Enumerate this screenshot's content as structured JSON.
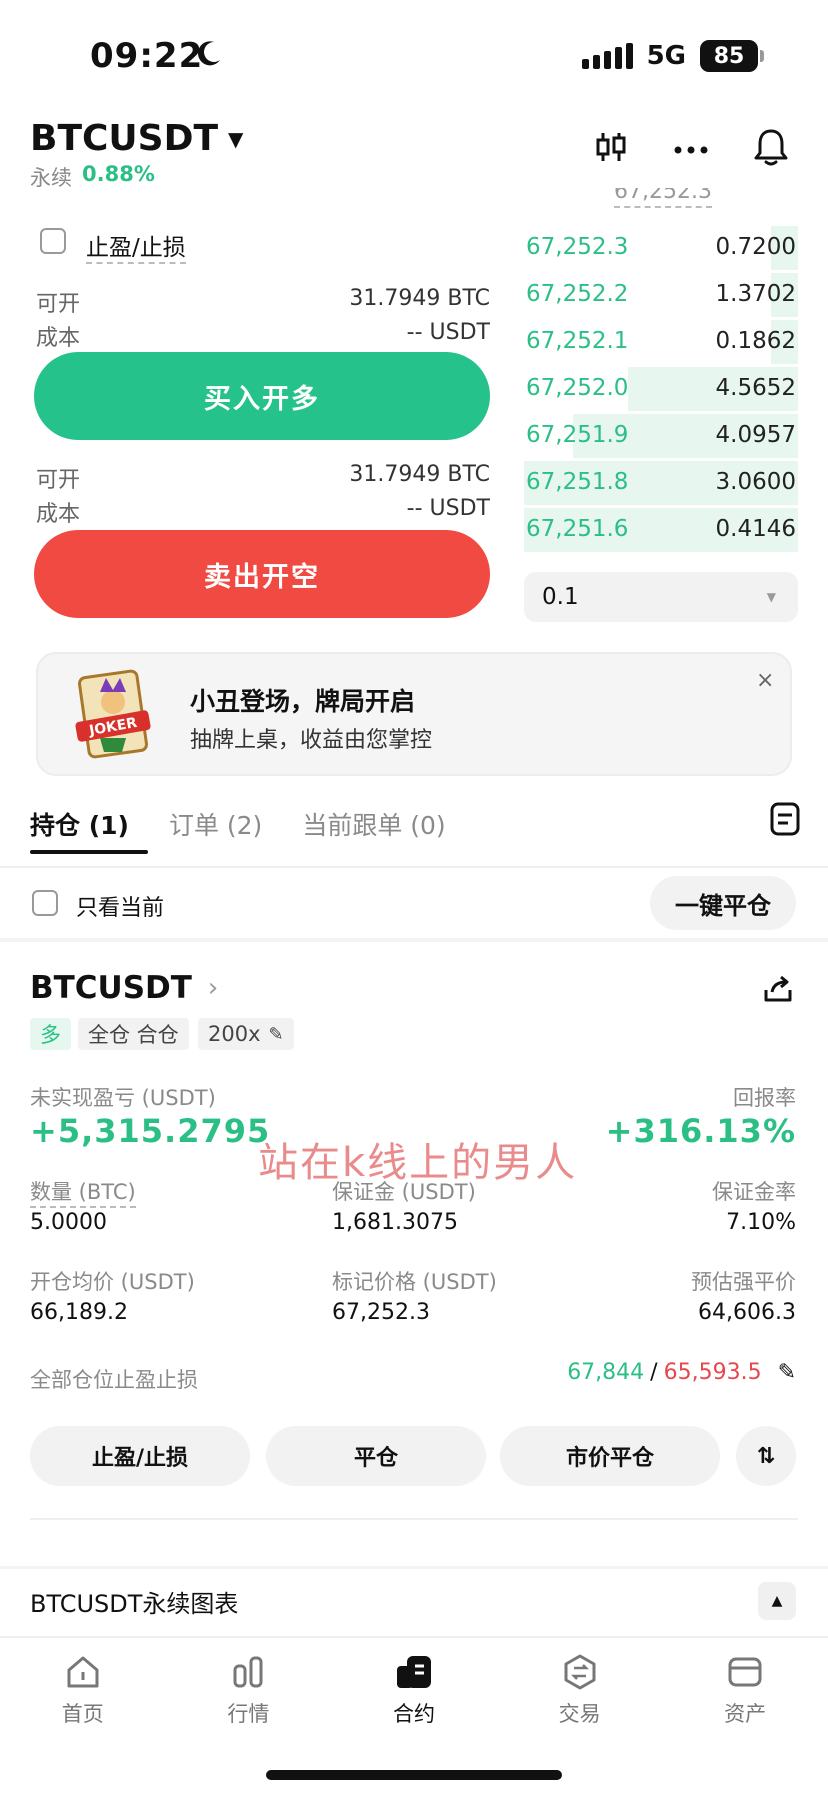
{
  "status_bar": {
    "time": "09:22",
    "network": "5G",
    "battery": "85"
  },
  "header": {
    "pair": "BTCUSDT",
    "type": "永续",
    "change": "0.88%"
  },
  "orderbook": {
    "top_price": "67,252.3",
    "rows": [
      {
        "price": "67,252.3",
        "amount": "0.7200",
        "depth": 0.1
      },
      {
        "price": "67,252.2",
        "amount": "1.3702",
        "depth": 0.1
      },
      {
        "price": "67,252.1",
        "amount": "0.1862",
        "depth": 0.1
      },
      {
        "price": "67,252.0",
        "amount": "4.5652",
        "depth": 0.62
      },
      {
        "price": "67,251.9",
        "amount": "4.0957",
        "depth": 0.82
      },
      {
        "price": "67,251.8",
        "amount": "3.0600",
        "depth": 1.0
      },
      {
        "price": "67,251.6",
        "amount": "0.4146",
        "depth": 1.0
      }
    ],
    "quantity": "0.1"
  },
  "order_form": {
    "tp_sl_label": "止盈/止损",
    "buy": {
      "open_label": "可开",
      "open_value": "31.7949 BTC",
      "cost_label": "成本",
      "cost_value": "-- USDT",
      "button": "买入开多"
    },
    "sell": {
      "open_label": "可开",
      "open_value": "31.7949 BTC",
      "cost_label": "成本",
      "cost_value": "-- USDT",
      "button": "卖出开空"
    }
  },
  "banner": {
    "title": "小丑登场，牌局开启",
    "subtitle": "抽牌上桌，收益由您掌控",
    "close": "×",
    "card_text": "JOKER"
  },
  "tabs": {
    "positions": "持仓 (1)",
    "orders": "订单 (2)",
    "copy": "当前跟单 (0)"
  },
  "filter": {
    "only_current": "只看当前",
    "close_all": "一键平仓"
  },
  "position": {
    "symbol": "BTCUSDT",
    "tags": {
      "side": "多",
      "mode": "全仓 合仓",
      "leverage": "200x"
    },
    "unrealized_label": "未实现盈亏 (USDT)",
    "unrealized_value": "+5,315.2795",
    "roe_label": "回报率",
    "roe_value": "+316.13%",
    "qty_label": "数量 (BTC)",
    "qty_value": "5.0000",
    "margin_label": "保证金 (USDT)",
    "margin_value": "1,681.3075",
    "margin_ratio_label": "保证金率",
    "margin_ratio_value": "7.10%",
    "entry_label": "开仓均价 (USDT)",
    "entry_value": "66,189.2",
    "mark_label": "标记价格 (USDT)",
    "mark_value": "67,252.3",
    "liq_label": "预估强平价",
    "liq_value": "64,606.3",
    "tpsl_label": "全部仓位止盈止损",
    "tp_value": "67,844",
    "sl_value": "65,593.5",
    "buttons": {
      "tpsl": "止盈/止损",
      "close": "平仓",
      "market_close": "市价平仓"
    }
  },
  "watermark": "站在k线上的男人",
  "chart_section": {
    "label": "BTCUSDT永续图表"
  },
  "nav": [
    {
      "label": "首页"
    },
    {
      "label": "行情"
    },
    {
      "label": "合约"
    },
    {
      "label": "交易"
    },
    {
      "label": "资产"
    }
  ]
}
